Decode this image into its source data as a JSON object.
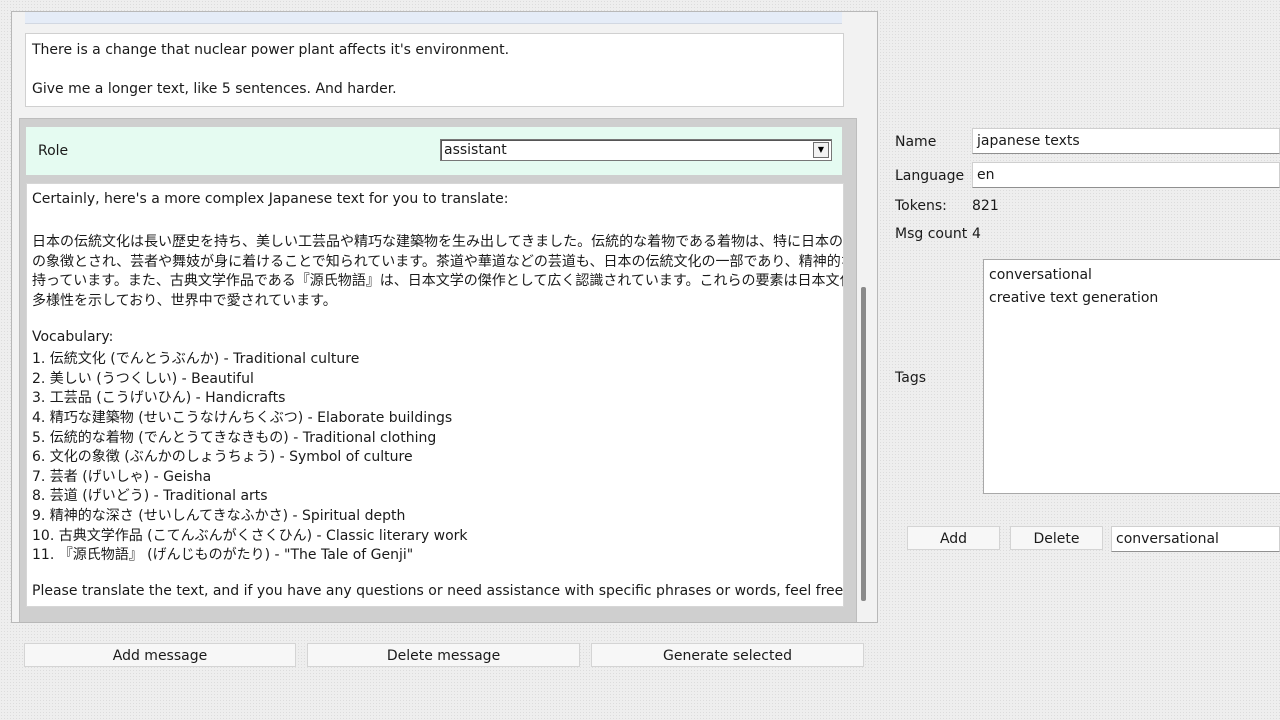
{
  "chat": {
    "user_message": {
      "line1": "There is a change that nuclear power plant affects it's environment.",
      "line2": "Give me a longer text, like 5 sentences. And harder."
    },
    "assistant_message": {
      "role_label": "Role",
      "role_value": "assistant",
      "intro": "Certainly, here's a more complex Japanese text for you to translate:",
      "jp_lines": [
        "日本の伝統文化は長い歴史を持ち、美しい工芸品や精巧な建築物を生み出してきました。伝統的な着物である着物は、特に日本の文化",
        "の象徴とされ、芸者や舞妓が身に着けることで知られています。茶道や華道などの芸道も、日本の伝統文化の一部であり、精神的な深さを",
        "持っています。また、古典文学作品である『源氏物語』は、日本文学の傑作として広く認識されています。これらの要素は日本文化の豊かさと",
        "多様性を示しており、世界中で愛されています。"
      ],
      "vocab_heading": "Vocabulary:",
      "vocab": [
        "1. 伝統文化 (でんとうぶんか) - Traditional culture",
        "2. 美しい (うつくしい) - Beautiful",
        "3. 工芸品 (こうげいひん) - Handicrafts",
        "4. 精巧な建築物 (せいこうなけんちくぶつ) - Elaborate buildings",
        "5. 伝統的な着物 (でんとうてきなきもの) - Traditional clothing",
        "6. 文化の象徴 (ぶんかのしょうちょう) - Symbol of culture",
        "7. 芸者 (げいしゃ) - Geisha",
        "8. 芸道 (げいどう) - Traditional arts",
        "9. 精神的な深さ (せいしんてきなふかさ) - Spiritual depth",
        "10. 古典文学作品 (こてんぶんがくさくひん) - Classic literary work",
        "11. 『源氏物語』 (げんじものがたり) - \"The Tale of Genji\""
      ],
      "closing": "Please translate the text, and if you have any questions or need assistance with specific phrases or words, feel free to ask!"
    }
  },
  "bottom_buttons": {
    "add_message": "Add message",
    "delete_message": "Delete message",
    "generate_selected": "Generate selected"
  },
  "sidebar": {
    "name_label": "Name",
    "name_value": "japanese texts",
    "language_label": "Language",
    "language_value": "en",
    "tokens_label": "Tokens:",
    "tokens_value": "821",
    "msg_count_label": "Msg count",
    "msg_count_value": "4",
    "tags_label": "Tags",
    "tags": [
      "conversational",
      "creative text generation"
    ],
    "add_button": "Add",
    "delete_button": "Delete",
    "tag_input_value": "conversational"
  },
  "colors": {
    "role_bar_bg": "#e5fbf1",
    "panel_bg": "#f2f2f2",
    "card_bg": "#cfcfcf"
  }
}
